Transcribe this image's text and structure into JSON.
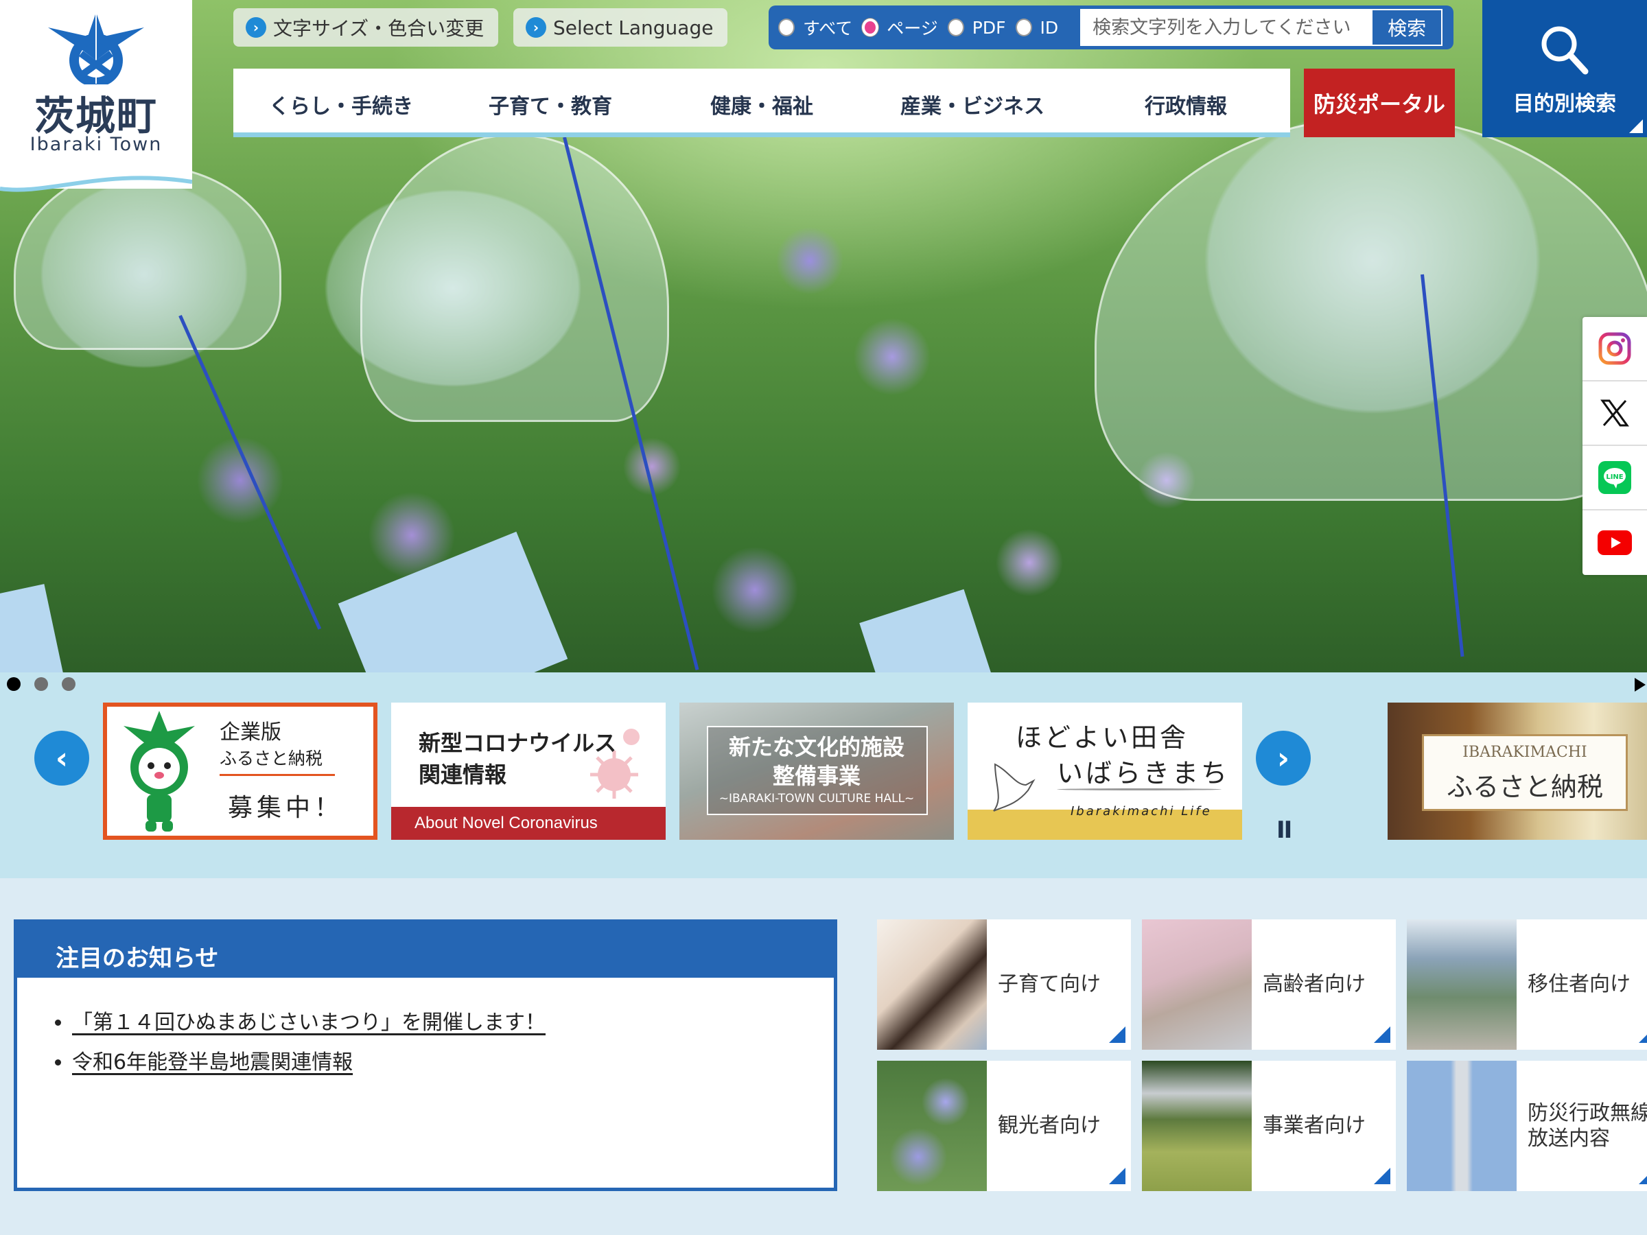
{
  "logo": {
    "name_jp": "茨城町",
    "name_en": "Ibaraki Town"
  },
  "utility": {
    "text_size_color": "文字サイズ・色合い変更",
    "select_language": "Select Language"
  },
  "search": {
    "scopes": [
      {
        "label": "すべて",
        "selected": false
      },
      {
        "label": "ページ",
        "selected": true
      },
      {
        "label": "PDF",
        "selected": false
      },
      {
        "label": "ID",
        "selected": false
      }
    ],
    "placeholder": "検索文字列を入力してください",
    "value": "",
    "button": "検索"
  },
  "nav": {
    "items": [
      "くらし・手続き",
      "子育て・教育",
      "健康・福祉",
      "産業・ビジネス",
      "行政情報"
    ],
    "disaster_portal": "防災ポータル"
  },
  "purpose_search": {
    "label": "目的別検索",
    "icon": "search-icon"
  },
  "sns": [
    "instagram-icon",
    "x-icon",
    "line-icon",
    "youtube-icon"
  ],
  "slider": {
    "slides": 3,
    "active": 1,
    "next_icon": "play-triangle"
  },
  "banners": [
    {
      "line1": "企業版",
      "line2": "ふるさと納税",
      "line3": "募集中！"
    },
    {
      "line1": "新型コロナウイルス",
      "line2": "関連情報",
      "footer": "About Novel Coronavirus"
    },
    {
      "line1": "新たな文化的施設",
      "line2": "整備事業",
      "line3": "~IBARAKI-TOWN CULTURE HALL~"
    },
    {
      "line1": "ほどよい田舎",
      "line2": "いばらきまち",
      "line3": "Ibarakimachi Life"
    },
    {
      "line1": "IBARAKIMACHI",
      "line2": "ふるさと納税"
    }
  ],
  "banner_controls": {
    "prev": "‹",
    "next": "›",
    "pause": "II"
  },
  "notice": {
    "title": "注目のお知らせ",
    "items": [
      "「第１４回ひぬまあじさいまつり」を開催します！",
      "令和6年能登半島地震関連情報"
    ]
  },
  "audience_cards": [
    {
      "label": "子育て向け"
    },
    {
      "label": "高齢者向け"
    },
    {
      "label": "移住者向け"
    },
    {
      "label": "観光者向け"
    },
    {
      "label": "事業者向け"
    },
    {
      "label": "防災行政無線放送内容"
    }
  ],
  "colors": {
    "primary": "#2566b4",
    "disaster": "#c32222",
    "purpose": "#0d55a6",
    "accent_radio": "#e8418f"
  }
}
